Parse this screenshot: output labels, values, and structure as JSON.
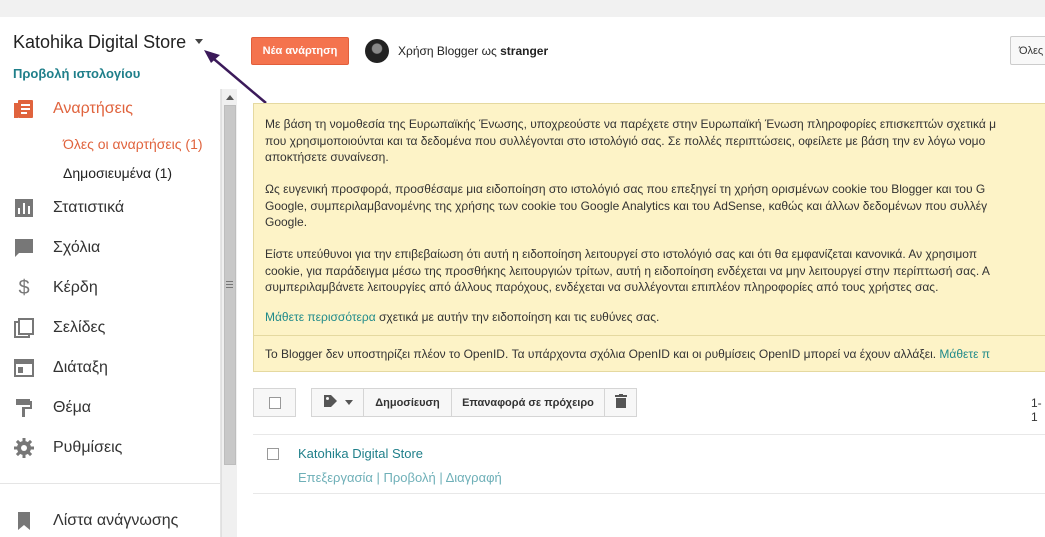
{
  "header": {
    "blog_title": "Katohika Digital Store",
    "view_blog": "Προβολή ιστολογίου",
    "new_post": "Νέα ανάρτηση",
    "using_prefix": "Χρήση Blogger ως ",
    "username": "stranger",
    "all_blogs_button": "Όλες"
  },
  "sidebar": {
    "posts_label": "Αναρτήσεις",
    "sub_all": "Όλες οι αναρτήσεις (1)",
    "sub_published": "Δημοσιευμένα (1)",
    "items": [
      {
        "label": "Στατιστικά",
        "icon": "stats-icon"
      },
      {
        "label": "Σχόλια",
        "icon": "comments-icon"
      },
      {
        "label": "Κέρδη",
        "icon": "dollar-icon"
      },
      {
        "label": "Σελίδες",
        "icon": "pages-icon"
      },
      {
        "label": "Διάταξη",
        "icon": "layout-icon"
      },
      {
        "label": "Θέμα",
        "icon": "theme-icon"
      },
      {
        "label": "Ρυθμίσεις",
        "icon": "settings-icon"
      }
    ],
    "reading_list": "Λίστα ανάγνωσης"
  },
  "notice": {
    "p1_l1": "Με βάση τη νομοθεσία της Ευρωπαϊκής Ένωσης, υποχρεούστε να παρέχετε στην Ευρωπαϊκή Ένωση πληροφορίες επισκεπτών σχετικά μ",
    "p1_l2": "που χρησιμοποιούνται και τα δεδομένα που συλλέγονται στο ιστολόγιό σας. Σε πολλές περιπτώσεις, οφείλετε με βάση την εν λόγω νομο",
    "p1_l3": "αποκτήσετε συναίνεση.",
    "p2_l1": "Ως ευγενική προσφορά, προσθέσαμε μια ειδοποίηση στο ιστολόγιό σας που επεξηγεί τη χρήση ορισμένων cookie του Blogger και του G",
    "p2_l2": "Google, συμπεριλαμβανομένης της χρήσης των cookie του Google Analytics και του AdSense, καθώς και άλλων δεδομένων που συλλέγ",
    "p2_l3": "Google.",
    "p3_l1": "Είστε υπεύθυνοι για την επιβεβαίωση ότι αυτή η ειδοποίηση λειτουργεί στο ιστολόγιό σας και ότι θα εμφανίζεται κανονικά. Αν χρησιμοπ",
    "p3_l2": "cookie, για παράδειγμα μέσω της προσθήκης λειτουργιών τρίτων, αυτή η ειδοποίηση ενδέχεται να μην λειτουργεί στην περίπτωσή σας. Α",
    "p3_l3": "συμπεριλαμβάνετε λειτουργίες από άλλους παρόχους, ενδέχεται να συλλέγονται επιπλέον πληροφορίες από τους χρήστες σας.",
    "learn_more": "Μάθετε περισσότερα",
    "learn_more_rest": " σχετικά με αυτήν την ειδοποίηση και τις ευθύνες σας.",
    "openid_text": "Το Blogger δεν υποστηρίζει πλέον το OpenID. Τα υπάρχοντα σχόλια OpenID και οι ρυθμίσεις OpenID μπορεί να έχουν αλλάξει. ",
    "openid_link": "Μάθετε π"
  },
  "toolbar": {
    "publish": "Δημοσίευση",
    "revert": "Επαναφορά σε πρόχειρο",
    "pager": "1-1"
  },
  "post": {
    "title": "Katohika Digital Store",
    "edit": "Επεξεργασία",
    "view": "Προβολή",
    "delete": "Διαγραφή",
    "sep": " | "
  },
  "colors": {
    "accent": "#e0633d",
    "link": "#1f7f8a",
    "notice_bg": "#fdf3c7",
    "new_post_bg": "#f4734e",
    "annotation_arrow": "#3b1a5a"
  }
}
